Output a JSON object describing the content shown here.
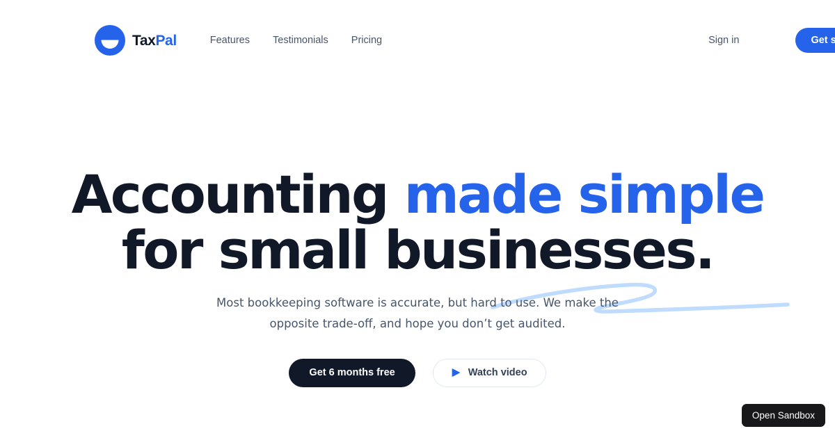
{
  "brand": {
    "logo_icon": "taxpal-circle-bowl-icon",
    "name_part_1": "Tax",
    "name_part_2": "Pal"
  },
  "header": {
    "nav_items": [
      {
        "label": "Features"
      },
      {
        "label": "Testimonials"
      },
      {
        "label": "Pricing"
      }
    ],
    "sign_in_label": "Sign in",
    "get_started_label": "Get started"
  },
  "hero": {
    "title_line1_part1": "Accounting ",
    "title_line1_accent": "made simple",
    "title_line2": "for small businesses.",
    "subtitle": "Most bookkeeping software is accurate, but hard to use. We make the opposite trade-off, and hope you don’t get audited.",
    "primary_cta": "Get 6 months free",
    "secondary_cta": "Watch video",
    "secondary_cta_icon": "play-icon",
    "underline_decoration": "hand-drawn-swoosh"
  },
  "overlay": {
    "sandbox_label": "Open Sandbox"
  },
  "colors": {
    "background": "#ffffff",
    "brand_blue": "#2563eb",
    "ink": "#111827",
    "muted_text": "#475569",
    "swoosh_blue": "#bfdbfe",
    "border": "#e2e8f0",
    "badge_black": "#18181b"
  }
}
